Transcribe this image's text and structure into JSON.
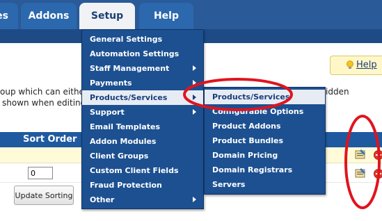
{
  "nav": {
    "tabs": [
      {
        "label": "es"
      },
      {
        "label": "Addons"
      },
      {
        "label": "Setup"
      },
      {
        "label": "Help"
      }
    ]
  },
  "page": {
    "desc_line1": "oup which can either",
    "desc_line2": "shown when editing",
    "desc_right": "idden",
    "help_label": "Help",
    "table_header": "Sort Order",
    "sort_value": "0",
    "update_button": "Update Sorting"
  },
  "setup_menu": {
    "items": [
      {
        "label": "General Settings"
      },
      {
        "label": "Automation Settings"
      },
      {
        "label": "Staff Management"
      },
      {
        "label": "Payments"
      },
      {
        "label": "Products/Services"
      },
      {
        "label": "Support"
      },
      {
        "label": "Email Templates"
      },
      {
        "label": "Addon Modules"
      },
      {
        "label": "Client Groups"
      },
      {
        "label": "Custom Client Fields"
      },
      {
        "label": "Fraud Protection"
      },
      {
        "label": "Other"
      }
    ]
  },
  "products_submenu": {
    "items": [
      {
        "label": "Products/Services"
      },
      {
        "label": "Configurable Options"
      },
      {
        "label": "Product Addons"
      },
      {
        "label": "Product Bundles"
      },
      {
        "label": "Domain Pricing"
      },
      {
        "label": "Domain Registrars"
      },
      {
        "label": "Servers"
      }
    ]
  },
  "colors": {
    "nav_bg": "#2a5a98",
    "menu_bg": "#1c5091",
    "annotation": "#e0141e"
  },
  "icons": {
    "help": "lightbulb-icon",
    "edit": "edit-icon",
    "delete": "delete-icon",
    "submenu": "chevron-right-icon"
  }
}
